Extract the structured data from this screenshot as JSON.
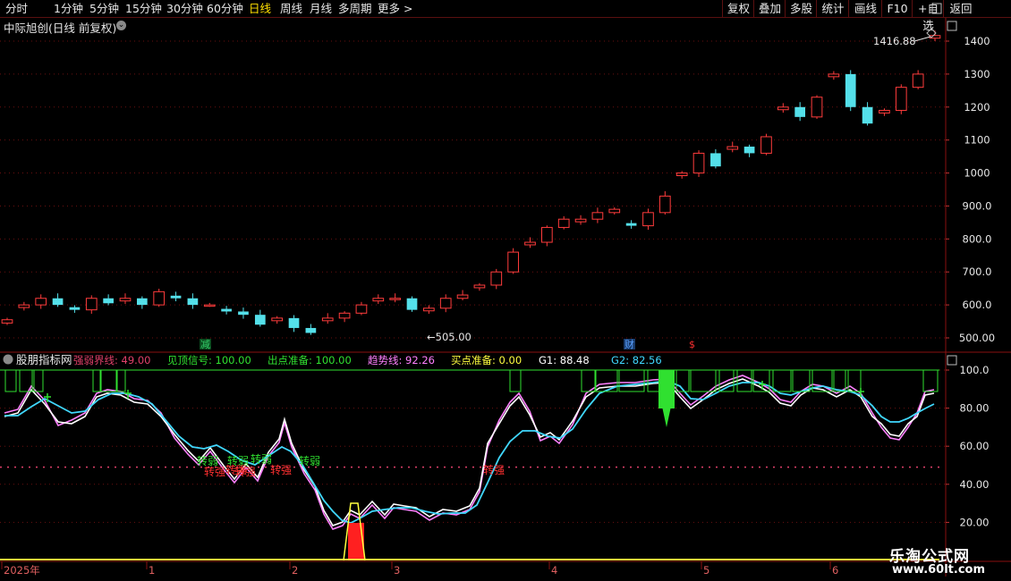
{
  "toolbar": {
    "periods": [
      "分时",
      "1分钟",
      "5分钟",
      "15分钟",
      "30分钟",
      "60分钟",
      "日线",
      "周线",
      "月线",
      "多周期",
      "更多 >"
    ],
    "active_period": "日线",
    "right_buttons": [
      "复权",
      "叠加",
      "多股",
      "统计",
      "画线",
      "F10",
      "+自选",
      "返回"
    ]
  },
  "main_chart": {
    "title": "中际旭创(日线 前复权)",
    "price_high_label": "1416.88",
    "price_low_label": "←505.00",
    "event_marks": [
      {
        "text": "减",
        "color": "#35d06a"
      },
      {
        "text": "财",
        "color": "#5aa0ff"
      },
      {
        "text": "$",
        "color": "#ff3030"
      }
    ],
    "y_ticks": [
      "1400",
      "1300",
      "1200",
      "1100",
      "1000",
      "900.0",
      "800.0",
      "700.0",
      "600.0",
      "500.00"
    ],
    "up_color": "#ff3c3c",
    "down_color": "#54e0ea"
  },
  "indicator": {
    "name": "股朋指标网",
    "values": [
      {
        "label": "强弱界线:",
        "value": "49.00",
        "color": "#e0406a"
      },
      {
        "label": "见顶信号:",
        "value": "100.00",
        "color": "#30e030"
      },
      {
        "label": "出点准备:",
        "value": "100.00",
        "color": "#30e030"
      },
      {
        "label": "趋势线:",
        "value": "92.26",
        "color": "#ff80ff"
      },
      {
        "label": "买点准备:",
        "value": "0.00",
        "color": "#ffff40"
      },
      {
        "label": "G1:",
        "value": "88.48",
        "color": "#ffffff"
      },
      {
        "label": "G2:",
        "value": "82.56",
        "color": "#40d8ff"
      }
    ],
    "y_ticks": [
      "100.0",
      "80.00",
      "60.00",
      "40.00",
      "20.00"
    ],
    "labels_green": [
      "转弱",
      "转弱",
      "转弱",
      "转弱"
    ],
    "labels_red": [
      "转强",
      "转强",
      "转强",
      "转强",
      "转强"
    ]
  },
  "time_axis": {
    "labels": [
      "2025年",
      "1",
      "2",
      "3",
      "4",
      "5",
      "6"
    ]
  },
  "watermark": {
    "line1": "乐淘公式网",
    "line2": "www.60lt.com"
  },
  "chart_data": {
    "type": "candlestick",
    "title": "中际旭创(日线 前复权)",
    "ylim": [
      480,
      1420
    ],
    "x_months": [
      "2025年",
      "1",
      "2",
      "3",
      "4",
      "5",
      "6"
    ],
    "closes_approx": [
      555,
      600,
      620,
      600,
      585,
      620,
      605,
      620,
      600,
      640,
      620,
      600,
      600,
      580,
      570,
      540,
      560,
      530,
      515,
      560,
      575,
      600,
      620,
      620,
      585,
      590,
      620,
      630,
      660,
      700,
      760,
      790,
      835,
      860,
      860,
      880,
      890,
      840,
      880,
      930,
      1000,
      1060,
      1020,
      1080,
      1060,
      1110,
      1200,
      1170,
      1230,
      1300,
      1200,
      1150,
      1190,
      1260,
      1300,
      1416.88
    ],
    "indicator": {
      "series": [
        {
          "name": "G1",
          "last": 88.48
        },
        {
          "name": "G2",
          "last": 82.56
        },
        {
          "name": "趋势线",
          "last": 92.26
        }
      ],
      "ylim": [
        0,
        105
      ],
      "threshold": 49.0
    }
  }
}
